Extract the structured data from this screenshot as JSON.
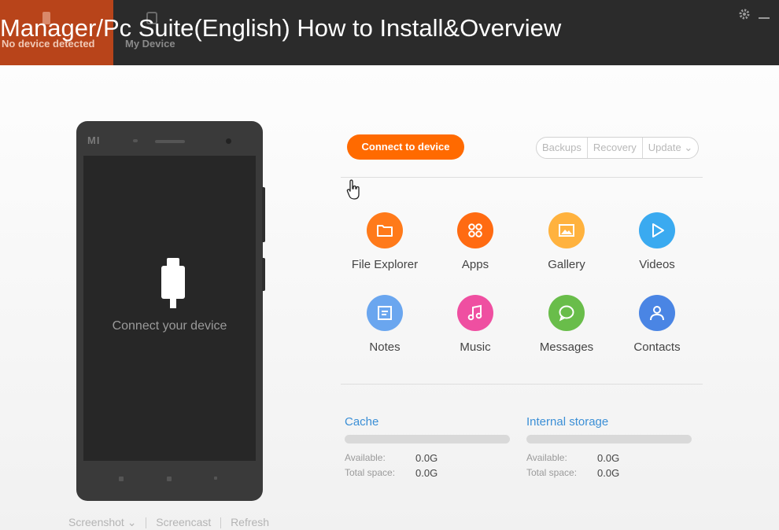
{
  "topbar": {
    "tabs": [
      {
        "label": "No device detected",
        "active": true
      },
      {
        "label": "My Device",
        "active": false
      }
    ],
    "video_title": "Manager/Pc Suite(English) How to Install&Overview",
    "icons": [
      "gear-icon",
      "minimize-icon"
    ]
  },
  "phone": {
    "logo": "MI",
    "screen_text": "Connect your device",
    "actions": [
      "Screenshot",
      "Screencast",
      "Refresh"
    ]
  },
  "toolbar": {
    "connect_label": "Connect to device",
    "segments": [
      "Backups",
      "Recovery",
      "Update"
    ]
  },
  "apps": [
    {
      "label": "File Explorer",
      "icon": "folder-icon",
      "color": "#ff7a1a"
    },
    {
      "label": "Apps",
      "icon": "apps-grid-icon",
      "color": "#ff6b12"
    },
    {
      "label": "Gallery",
      "icon": "image-icon",
      "color": "#ffb23e"
    },
    {
      "label": "Videos",
      "icon": "play-icon",
      "color": "#3aaaf0"
    },
    {
      "label": "Notes",
      "icon": "note-icon",
      "color": "#6aa6ef"
    },
    {
      "label": "Music",
      "icon": "music-note-icon",
      "color": "#ef4fa1"
    },
    {
      "label": "Messages",
      "icon": "chat-bubble-icon",
      "color": "#69bd4a"
    },
    {
      "label": "Contacts",
      "icon": "person-icon",
      "color": "#4a85e4"
    }
  ],
  "storage": [
    {
      "title": "Cache",
      "available_label": "Available:",
      "available": "0.0G",
      "total_label": "Total space:",
      "total": "0.0G"
    },
    {
      "title": "Internal storage",
      "available_label": "Available:",
      "available": "0.0G",
      "total_label": "Total space:",
      "total": "0.0G"
    }
  ]
}
